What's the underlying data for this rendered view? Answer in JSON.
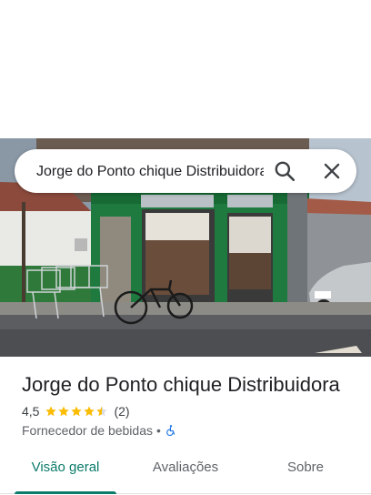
{
  "search": {
    "query": "Jorge do Ponto chique Distribuidora"
  },
  "place": {
    "name": "Jorge do Ponto chique Distribuidora",
    "rating": "4,5",
    "rating_value": 4.5,
    "review_count": "(2)",
    "category": "Fornecedor de bebidas",
    "separator": "•",
    "accessibility_icon": "wheelchair-icon"
  },
  "tabs": [
    {
      "label": "Visão geral",
      "active": true
    },
    {
      "label": "Avaliações",
      "active": false
    },
    {
      "label": "Sobre",
      "active": false
    }
  ],
  "colors": {
    "accent": "#0b7b6a",
    "star": "#fbbc04",
    "accessibility": "#1a73e8",
    "storefront_green": "#1e7a3e"
  },
  "icons": {
    "search": "search-icon",
    "close": "close-icon"
  }
}
